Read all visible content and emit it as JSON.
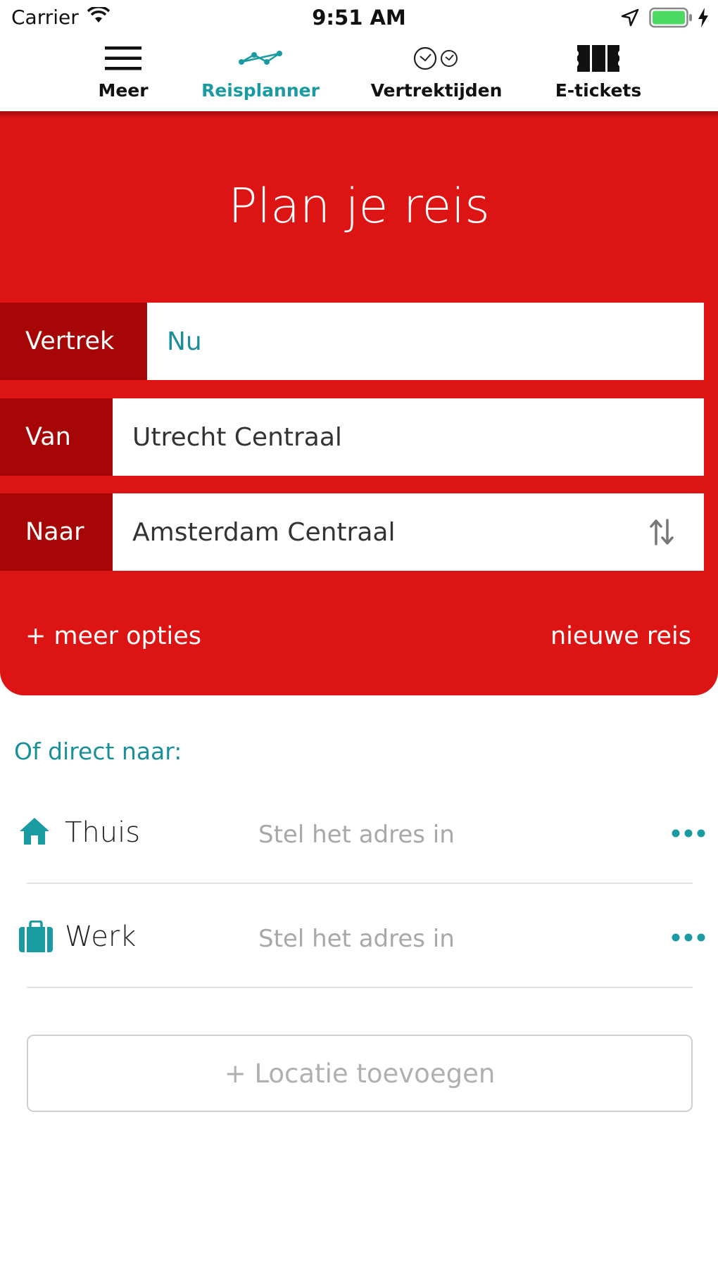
{
  "status_bar": {
    "carrier": "Carrier",
    "time": "9:51 AM",
    "battery_color": "#4cd964"
  },
  "tabs": [
    {
      "label": "Meer",
      "icon": "hamburger-menu-icon",
      "active": false
    },
    {
      "label": "Reisplanner",
      "icon": "route-icon",
      "active": true
    },
    {
      "label": "Vertrektijden",
      "icon": "clocks-icon",
      "active": false
    },
    {
      "label": "E-tickets",
      "icon": "ticket-icon",
      "active": false
    }
  ],
  "planner": {
    "title": "Plan je reis",
    "departure_label": "Vertrek",
    "departure_value": "Nu",
    "from_label": "Van",
    "from_value": "Utrecht Centraal",
    "to_label": "Naar",
    "to_value": "Amsterdam Centraal",
    "more_options": "+ meer opties",
    "new_trip": "nieuwe reis"
  },
  "direct": {
    "heading": "Of direct naar:",
    "favorites": [
      {
        "name": "Thuis",
        "icon": "home-icon",
        "address": "Stel het adres in"
      },
      {
        "name": "Werk",
        "icon": "briefcase-icon",
        "address": "Stel het adres in"
      }
    ],
    "add_location": "+ Locatie toevoegen"
  },
  "colors": {
    "brand_red": "#dd1414",
    "label_red": "#a60606",
    "accent_teal": "#1a9ba1"
  }
}
